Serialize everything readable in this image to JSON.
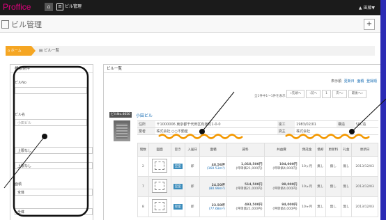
{
  "topbar": {
    "brand": "Proffice",
    "home": "⌂",
    "nav_item": "ビル管理",
    "nav_icon": "田",
    "user": "▲ 田藤▼"
  },
  "titlebar": {
    "title": "ビル管理",
    "plus": "+"
  },
  "breadcrumb": {
    "home": "ホーム",
    "current": "ビル一覧"
  },
  "search": {
    "header": "検索条件",
    "fields": [
      {
        "label": "ビルNo",
        "value": ""
      },
      {
        "label": "ビル名",
        "value": "小田ビル"
      },
      {
        "label": "",
        "value": "上限なし"
      },
      {
        "label": "",
        "value": "上限なし"
      },
      {
        "label": "面積",
        "value": "全体"
      },
      {
        "label": "",
        "value": "全体"
      }
    ]
  },
  "main": {
    "header": "ビル一覧",
    "display_label": "表示順",
    "display_links": [
      "更新日",
      "面積",
      "登録順"
    ],
    "count": "全1件中1〜1件を表示",
    "pager": [
      "«先頭へ",
      "‹前へ",
      "1",
      "次へ›",
      "最後へ»"
    ],
    "building": {
      "tag": "ビルNo.4650",
      "name": "小田ビル",
      "address_label": "住所",
      "address": "〒1000006 東京都千代田区有楽町1-0-0",
      "built_label": "竣工",
      "built": "1983/02/01",
      "structure_label": "構造",
      "structure": "SRC造",
      "company_label": "業者",
      "company": "株式会社 ○○不動産",
      "owner_label": "貸主",
      "owner": "株式会社"
    },
    "columns": [
      "階数",
      "図面",
      "空き",
      "入居日",
      "面積",
      "賃料",
      "共益費",
      "預託金",
      "償却",
      "更新料",
      "礼金",
      "更新日"
    ],
    "rows": [
      {
        "floor": "2",
        "status": "空室",
        "move": "即",
        "area": "48.56坪",
        "area_m": "(160.53m²)",
        "rent": "1,018,500円",
        "rent_unit": "(坪単価21,000円)",
        "fee": "194,000円",
        "fee_unit": "(坪単価4,000円)",
        "deposit": "10ヶ月",
        "amort": "無し",
        "renew_fee": "無し",
        "key": "無し",
        "updated": "2013/12/03"
      },
      {
        "floor": "7",
        "status": "空室",
        "move": "即",
        "area": "24.50坪",
        "area_m": "(80.99m²)",
        "rent": "514,500円",
        "rent_unit": "(坪単価21,000円)",
        "fee": "98,000円",
        "fee_unit": "(坪単価4,000円)",
        "deposit": "10ヶ月",
        "amort": "無し",
        "renew_fee": "無し",
        "key": "無し",
        "updated": "2013/12/03"
      },
      {
        "floor": "8",
        "status": "空室",
        "move": "即",
        "area": "23.50坪",
        "area_m": "(77.68m²)",
        "rent": "493,500円",
        "rent_unit": "(坪単価21,000円)",
        "fee": "94,000円",
        "fee_unit": "(坪単価4,000円)",
        "deposit": "10ヶ月",
        "amort": "無し",
        "renew_fee": "無し",
        "key": "無し",
        "updated": "2013/12/03"
      }
    ]
  }
}
